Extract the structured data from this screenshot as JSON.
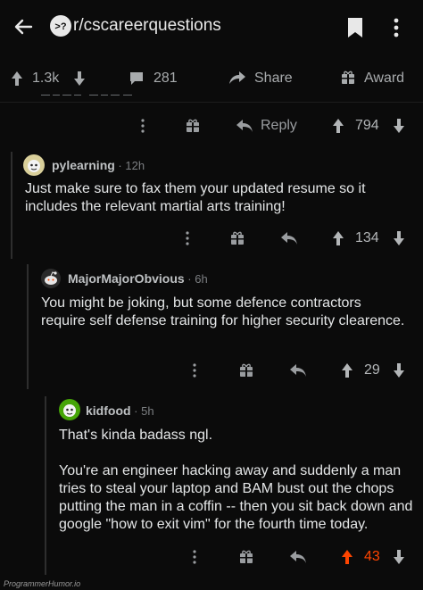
{
  "header": {
    "subreddit": "r/cscareerquestions",
    "icons": [
      "back-arrow-icon",
      "subreddit-logo-icon",
      "bookmark-icon",
      "more-vertical-icon"
    ]
  },
  "post_stats": {
    "upvotes": "1.3k",
    "comments": "281",
    "share_label": "Share",
    "award_label": "Award"
  },
  "truncated_comment": {
    "reply_label": "Reply",
    "votes": "794"
  },
  "comments": [
    {
      "username": "pylearning",
      "age": "12h",
      "body": "Just make sure to fax them your updated resume so it includes the relevant martial arts training!",
      "votes": "134"
    },
    {
      "username": "MajorMajorObvious",
      "age": "6h",
      "body": "You might be joking, but some defence contractors require self defense training for higher security clearence.",
      "votes": "29"
    },
    {
      "username": "kidfood",
      "age": "5h",
      "body_line1": "That's kinda badass ngl.",
      "body_line2": "You're an engineer hacking away and suddenly a man tries to steal your laptop and BAM bust out the chops putting the man in a coffin -- then you sit back down and google \"how to exit vim\" for the fourth time today.",
      "votes": "43",
      "upvoted": true
    }
  ],
  "colors": {
    "background": "#0b0b0b",
    "upvote_active": "#ff4500",
    "text": "#e4e6e7",
    "muted": "#9a9da0"
  },
  "watermark": "ProgrammerHumor.io"
}
